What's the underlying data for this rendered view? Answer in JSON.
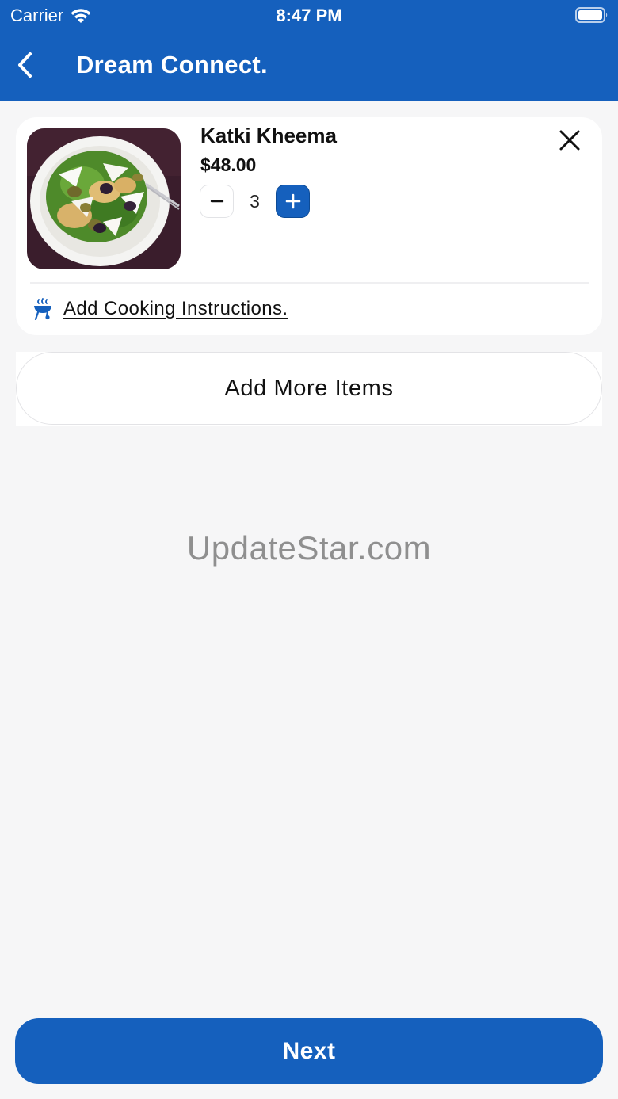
{
  "status_bar": {
    "carrier": "Carrier",
    "time": "8:47 PM"
  },
  "nav": {
    "title": "Dream Connect.",
    "back_icon": "chevron-left-icon"
  },
  "cart_item": {
    "name": "Katki Kheema",
    "price": "$48.00",
    "quantity": "3",
    "image": "pasta-salad-plate",
    "remove_icon": "close-icon",
    "cooking_instructions_label": "Add Cooking Instructions.",
    "cooking_icon": "grill-icon"
  },
  "actions": {
    "add_more_label": "Add More Items",
    "next_label": "Next"
  },
  "watermark": "UpdateStar.com",
  "colors": {
    "primary": "#1560bd",
    "background": "#f6f6f7",
    "card": "#ffffff"
  }
}
